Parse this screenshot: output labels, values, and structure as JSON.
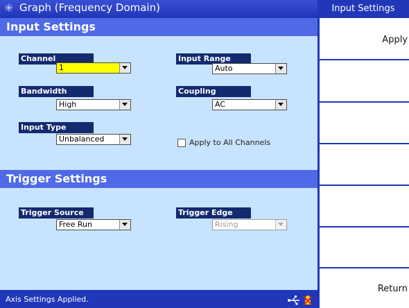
{
  "window": {
    "title": "Graph (Frequency Domain)"
  },
  "input_settings": {
    "header": "Input Settings",
    "channel": {
      "label": "Channel",
      "value": "1"
    },
    "input_range": {
      "label": "Input Range",
      "value": "Auto"
    },
    "bandwidth": {
      "label": "Bandwidth",
      "value": "High"
    },
    "coupling": {
      "label": "Coupling",
      "value": "AC"
    },
    "input_type": {
      "label": "Input Type",
      "value": "Unbalanced"
    },
    "apply_all": {
      "label": "Apply to All Channels",
      "checked": false
    }
  },
  "trigger_settings": {
    "header": "Trigger Settings",
    "trigger_source": {
      "label": "Trigger Source",
      "value": "Free Run"
    },
    "trigger_edge": {
      "label": "Trigger Edge",
      "value": "Rising",
      "enabled": false
    }
  },
  "status": {
    "message": "Axis Settings Applied."
  },
  "softkeys": {
    "title": "Input Settings",
    "apply": "Apply",
    "return": "Return"
  },
  "colors": {
    "title_bar": "#1f36b8",
    "section_header": "#4f6ae6",
    "panel_bg": "#c7e3ff",
    "field_label_bg": "#142a6e",
    "highlight": "#ffff00"
  }
}
